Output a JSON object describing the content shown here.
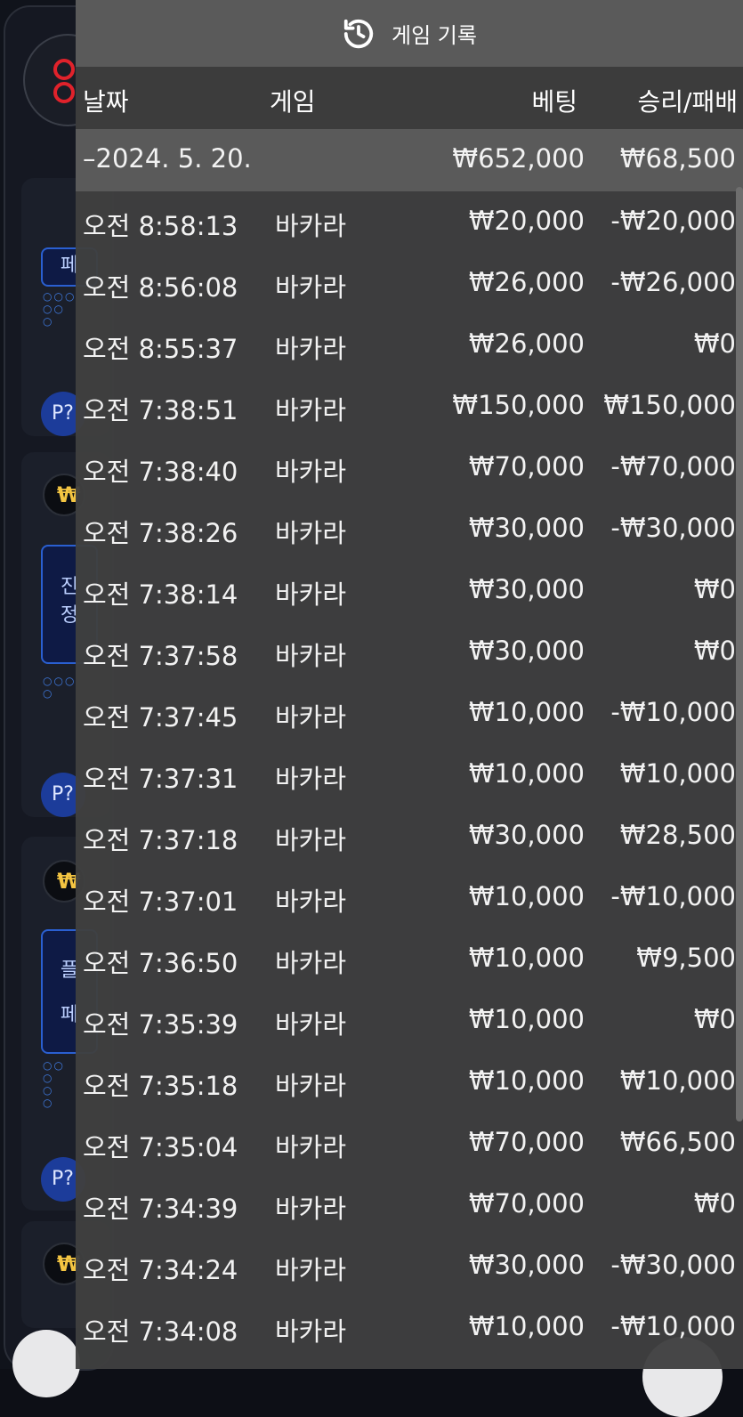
{
  "panel": {
    "title": "게임 기록",
    "columns": {
      "date": "날짜",
      "game": "게임",
      "bet": "베팅",
      "result": "승리/패배"
    },
    "date_group": {
      "date": "–2024. 5. 20.",
      "total_bet": "₩652,000",
      "total_result": "₩68,500"
    },
    "rows": [
      {
        "time": "오전 8:58:13",
        "game": "바카라",
        "bet": "₩20,000",
        "result": "-₩20,000"
      },
      {
        "time": "오전 8:56:08",
        "game": "바카라",
        "bet": "₩26,000",
        "result": "-₩26,000"
      },
      {
        "time": "오전 8:55:37",
        "game": "바카라",
        "bet": "₩26,000",
        "result": "₩0"
      },
      {
        "time": "오전 7:38:51",
        "game": "바카라",
        "bet": "₩150,000",
        "result": "₩150,000"
      },
      {
        "time": "오전 7:38:40",
        "game": "바카라",
        "bet": "₩70,000",
        "result": "-₩70,000"
      },
      {
        "time": "오전 7:38:26",
        "game": "바카라",
        "bet": "₩30,000",
        "result": "-₩30,000"
      },
      {
        "time": "오전 7:38:14",
        "game": "바카라",
        "bet": "₩30,000",
        "result": "₩0"
      },
      {
        "time": "오전 7:37:58",
        "game": "바카라",
        "bet": "₩30,000",
        "result": "₩0"
      },
      {
        "time": "오전 7:37:45",
        "game": "바카라",
        "bet": "₩10,000",
        "result": "-₩10,000"
      },
      {
        "time": "오전 7:37:31",
        "game": "바카라",
        "bet": "₩10,000",
        "result": "₩10,000"
      },
      {
        "time": "오전 7:37:18",
        "game": "바카라",
        "bet": "₩30,000",
        "result": "₩28,500"
      },
      {
        "time": "오전 7:37:01",
        "game": "바카라",
        "bet": "₩10,000",
        "result": "-₩10,000"
      },
      {
        "time": "오전 7:36:50",
        "game": "바카라",
        "bet": "₩10,000",
        "result": "₩9,500"
      },
      {
        "time": "오전 7:35:39",
        "game": "바카라",
        "bet": "₩10,000",
        "result": "₩0"
      },
      {
        "time": "오전 7:35:18",
        "game": "바카라",
        "bet": "₩10,000",
        "result": "₩10,000"
      },
      {
        "time": "오전 7:35:04",
        "game": "바카라",
        "bet": "₩70,000",
        "result": "₩66,500"
      },
      {
        "time": "오전 7:34:39",
        "game": "바카라",
        "bet": "₩70,000",
        "result": "₩0"
      },
      {
        "time": "오전 7:34:24",
        "game": "바카라",
        "bet": "₩30,000",
        "result": "-₩30,000"
      },
      {
        "time": "오전 7:34:08",
        "game": "바카라",
        "bet": "₩10,000",
        "result": "-₩10,000"
      }
    ]
  },
  "background": {
    "p_button_label": "P?",
    "won_symbol": "₩",
    "blue_box_1": "페",
    "blue_box_2": "진\n정",
    "blue_box_3": "플\n페"
  },
  "colors": {
    "panel_bg": "#404040",
    "title_bar": "#5a5a5a",
    "header_bar": "#3c3c3c",
    "brand_red": "#e0222b"
  },
  "icons": {
    "title_icon": "history-icon"
  }
}
